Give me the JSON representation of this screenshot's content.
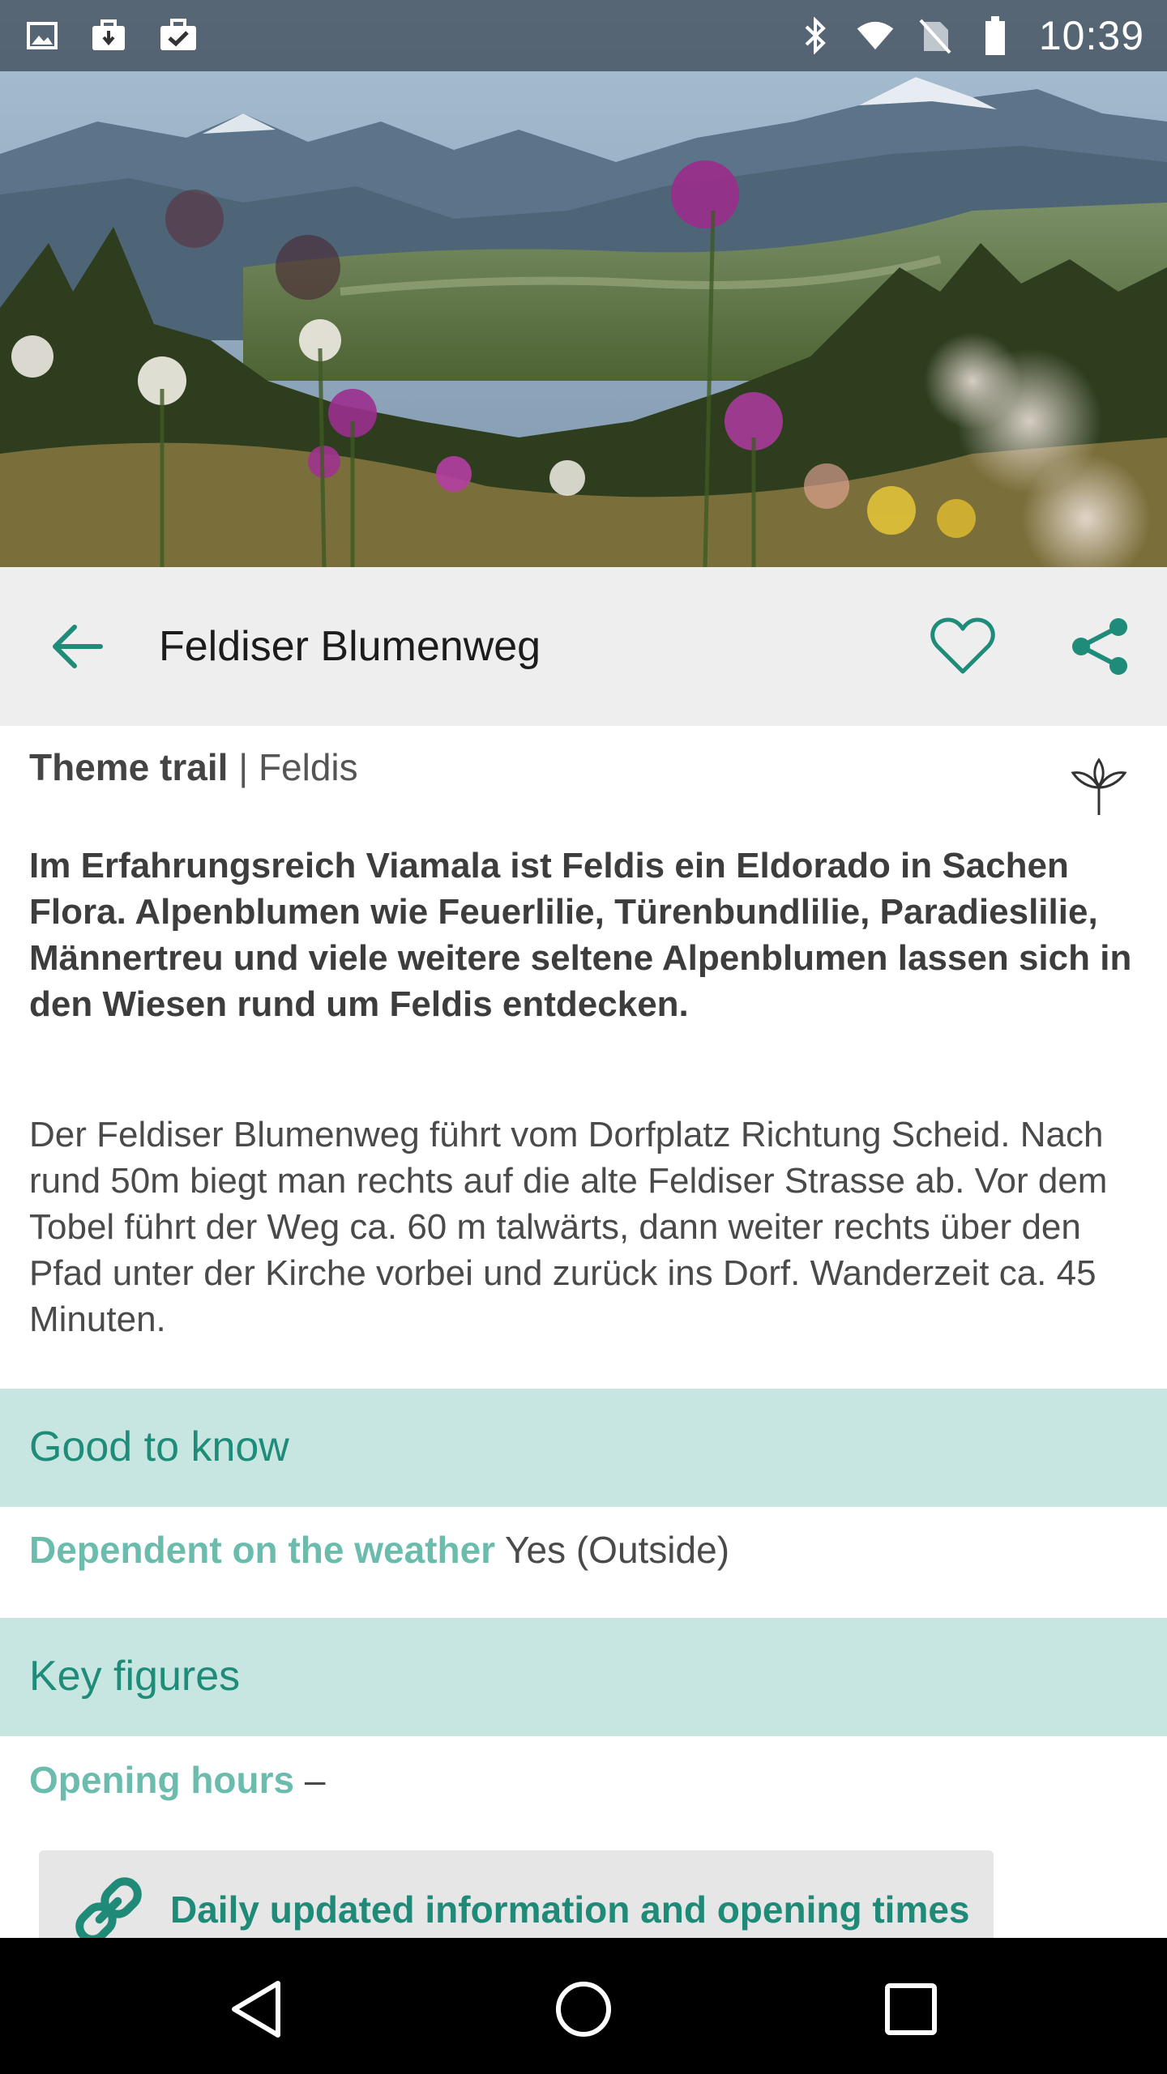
{
  "status_bar": {
    "time": "10:39",
    "left_icons": [
      "image-icon",
      "briefcase-download-icon",
      "briefcase-check-icon"
    ],
    "right_icons": [
      "bluetooth-icon",
      "wifi-icon",
      "no-sim-icon",
      "battery-icon"
    ]
  },
  "hero": {
    "image": "alpine-meadow-flowers-photo"
  },
  "app_bar": {
    "title": "Feldiser Blumenweg",
    "back_icon": "arrow-left-icon",
    "favorite_icon": "heart-outline-icon",
    "share_icon": "share-icon"
  },
  "detail": {
    "category_type": "Theme trail",
    "category_separator": " | ",
    "category_place": "Feldis",
    "category_icon": "plant-icon",
    "lead": "Im Erfahrungsreich Viamala ist Feldis ein Eldorado in Sachen Flora. Alpenblumen wie Feuerlilie, Türenbundlilie, Paradieslilie, Männertreu und viele weitere seltene Alpenblumen lassen sich in den Wiesen rund um Feldis entdecken.",
    "body": "Der Feldiser Blumenweg führt vom Dorfplatz Richtung Scheid. Nach rund 50m biegt man rechts auf die alte Feldiser Strasse ab. Vor dem Tobel führt der Weg ca. 60 m talwärts, dann weiter rechts über den Pfad unter der Kirche vorbei und zurück ins Dorf. Wanderzeit ca. 45 Minuten."
  },
  "good_to_know": {
    "heading": "Good to know",
    "weather_key": "Dependent on the weather",
    "weather_value": " Yes (Outside)"
  },
  "key_figures": {
    "heading": "Key figures",
    "hours_key": "Opening hours",
    "hours_value": " –",
    "link_label": "Daily updated information and opening times",
    "link_icon": "link-icon"
  },
  "nav_bar": {
    "back": "nav-back-icon",
    "home": "nav-home-icon",
    "recents": "nav-recents-icon"
  },
  "colors": {
    "accent": "#1e8c79",
    "accent_light": "#6cbcae",
    "section_bg": "#c8e6e1",
    "app_bar_bg": "#eeeeee",
    "card_bg": "#e6e6e6"
  }
}
